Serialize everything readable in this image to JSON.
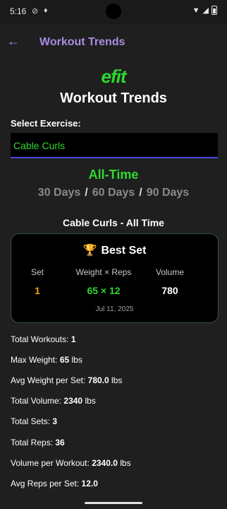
{
  "status_bar": {
    "time": "5:16"
  },
  "app_bar": {
    "title": "Workout Trends"
  },
  "logo_text": "efit",
  "page_title": "Workout Trends",
  "select": {
    "label": "Select Exercise:",
    "value": "Cable Curls"
  },
  "range": {
    "active": "All-Time",
    "options": [
      "30 Days",
      "60 Days",
      "90 Days"
    ],
    "separator": "/"
  },
  "section_title": "Cable Curls - All Time",
  "best_set": {
    "title": "Best Set",
    "headers": [
      "Set",
      "Weight × Reps",
      "Volume"
    ],
    "values": [
      "1",
      "65 × 12",
      "780"
    ],
    "date": "Jul 11, 2025"
  },
  "stats": [
    {
      "label": "Total Workouts:",
      "value": "1"
    },
    {
      "label": "Max Weight:",
      "value": "65",
      "unit": "lbs"
    },
    {
      "label": "Avg Weight per Set:",
      "value": "780.0",
      "unit": "lbs"
    },
    {
      "label": "Total Volume:",
      "value": "2340",
      "unit": "lbs"
    },
    {
      "label": "Total Sets:",
      "value": "3"
    },
    {
      "label": "Total Reps:",
      "value": "36"
    },
    {
      "label": "Volume per Workout:",
      "value": "2340.0",
      "unit": "lbs"
    },
    {
      "label": "Avg Reps per Set:",
      "value": "12.0"
    }
  ],
  "colors": {
    "accent_purple": "#a88be0",
    "accent_green": "#2fd82f",
    "set_orange": "#f2a500",
    "background": "#1f1f1f"
  },
  "icons": {
    "back": "arrow-left-icon",
    "trophy": "trophy-icon"
  }
}
